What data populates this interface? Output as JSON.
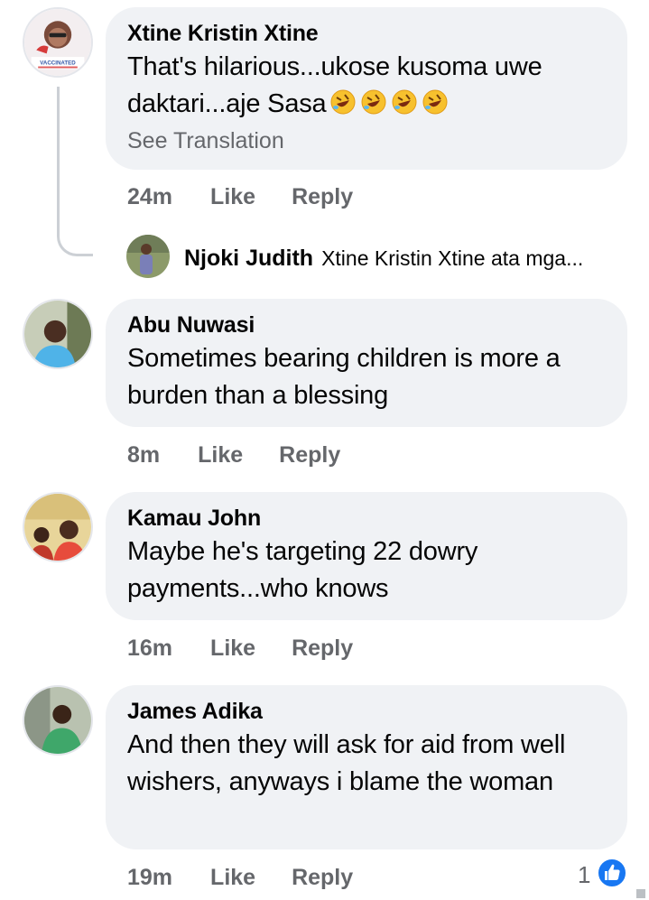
{
  "comments": [
    {
      "author": "Xtine Kristin Xtine",
      "text": "That's hilarious...ukose kusoma uwe daktari...aje Sasa",
      "see_translation": "See Translation",
      "time": "24m",
      "like": "Like",
      "reply": "Reply",
      "avatar_badge": "VACCINATED"
    },
    {
      "author": "Abu Nuwasi",
      "text": "Sometimes bearing children is more a burden than a blessing",
      "time": "8m",
      "like": "Like",
      "reply": "Reply"
    },
    {
      "author": "Kamau John",
      "text": "Maybe he's targeting 22 dowry payments...who knows",
      "time": "16m",
      "like": "Like",
      "reply": "Reply"
    },
    {
      "author": "James Adika",
      "text": "And then they will ask for aid from well wishers, anyways i blame the woman",
      "time": "19m",
      "like": "Like",
      "reply": "Reply",
      "reaction_count": "1"
    }
  ],
  "reply_preview": {
    "author": "Njoki Judith",
    "text": "Xtine Kristin Xtine ata mga..."
  },
  "icons": {
    "emoji": "rolling-on-floor-laughing",
    "reaction": "like-thumbs-up"
  },
  "colors": {
    "bubble": "#f0f2f5",
    "meta_text": "#65676b",
    "like_blue": "#1877f2"
  }
}
